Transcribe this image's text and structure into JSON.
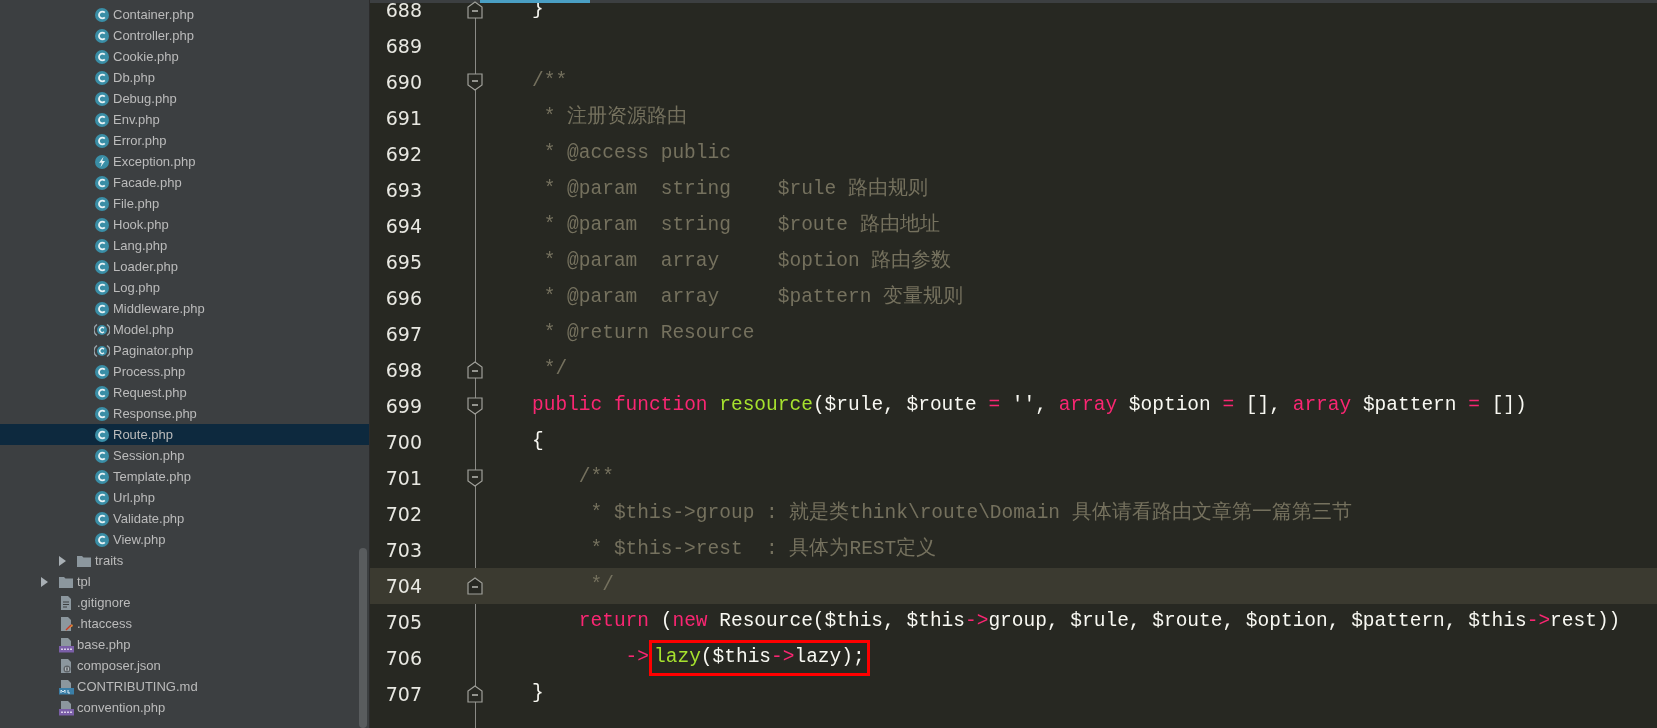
{
  "sidebar": {
    "tree": [
      {
        "children": [
          {
            "children": [
              {
                "label": "Container.php",
                "kind": "class",
                "selected": false
              },
              {
                "label": "Controller.php",
                "kind": "class",
                "selected": false
              },
              {
                "label": "Cookie.php",
                "kind": "class",
                "selected": false
              },
              {
                "label": "Db.php",
                "kind": "class",
                "selected": false
              },
              {
                "label": "Debug.php",
                "kind": "class",
                "selected": false
              },
              {
                "label": "Env.php",
                "kind": "class",
                "selected": false
              },
              {
                "label": "Error.php",
                "kind": "class",
                "selected": false
              },
              {
                "label": "Exception.php",
                "kind": "exception",
                "selected": false
              },
              {
                "label": "Facade.php",
                "kind": "class",
                "selected": false
              },
              {
                "label": "File.php",
                "kind": "class",
                "selected": false
              },
              {
                "label": "Hook.php",
                "kind": "class",
                "selected": false
              },
              {
                "label": "Lang.php",
                "kind": "class",
                "selected": false
              },
              {
                "label": "Loader.php",
                "kind": "class",
                "selected": false
              },
              {
                "label": "Log.php",
                "kind": "class",
                "selected": false
              },
              {
                "label": "Middleware.php",
                "kind": "class",
                "selected": false
              },
              {
                "label": "Model.php",
                "kind": "abstract",
                "selected": false
              },
              {
                "label": "Paginator.php",
                "kind": "abstract",
                "selected": false
              },
              {
                "label": "Process.php",
                "kind": "class",
                "selected": false
              },
              {
                "label": "Request.php",
                "kind": "class",
                "selected": false
              },
              {
                "label": "Response.php",
                "kind": "class",
                "selected": false
              },
              {
                "label": "Route.php",
                "kind": "class",
                "selected": true
              },
              {
                "label": "Session.php",
                "kind": "class",
                "selected": false
              },
              {
                "label": "Template.php",
                "kind": "class",
                "selected": false
              },
              {
                "label": "Url.php",
                "kind": "class",
                "selected": false
              },
              {
                "label": "Validate.php",
                "kind": "class",
                "selected": false
              },
              {
                "label": "View.php",
                "kind": "class",
                "selected": false
              }
            ]
          },
          {
            "label": "traits",
            "kind": "folder",
            "selected": false,
            "expanded": false
          }
        ]
      },
      {
        "label": "tpl",
        "kind": "folder",
        "selected": false,
        "expanded": false
      },
      {
        "label": ".gitignore",
        "kind": "text",
        "selected": false
      },
      {
        "label": ".htaccess",
        "kind": "htaccess",
        "selected": false
      },
      {
        "label": "base.php",
        "kind": "php",
        "selected": false
      },
      {
        "label": "composer.json",
        "kind": "json",
        "selected": false
      },
      {
        "label": "CONTRIBUTING.md",
        "kind": "md",
        "selected": false
      },
      {
        "label": "convention.php",
        "kind": "php",
        "selected": false
      }
    ]
  },
  "editor": {
    "lines": [
      {
        "number": "688",
        "kind": "fold-end",
        "current": false,
        "tokens": [
          {
            "kind": "plain",
            "text": "}"
          }
        ]
      },
      {
        "number": "689",
        "kind": "plain",
        "current": false
      },
      {
        "number": "690",
        "kind": "fold-start",
        "current": false,
        "tokens": [
          {
            "kind": "comment",
            "text": "/**"
          }
        ]
      },
      {
        "number": "691",
        "kind": "plain",
        "current": false,
        "tokens": [
          {
            "kind": "comment",
            "text": " * 注册资源路由"
          }
        ]
      },
      {
        "number": "692",
        "kind": "plain",
        "current": false,
        "tokens": [
          {
            "kind": "comment",
            "text": " * @access public"
          }
        ]
      },
      {
        "number": "693",
        "kind": "plain",
        "current": false,
        "tokens": [
          {
            "kind": "comment",
            "text": " * @param  string    $rule 路由规则"
          }
        ]
      },
      {
        "number": "694",
        "kind": "plain",
        "current": false,
        "tokens": [
          {
            "kind": "comment",
            "text": " * @param  string    $route 路由地址"
          }
        ]
      },
      {
        "number": "695",
        "kind": "plain",
        "current": false,
        "tokens": [
          {
            "kind": "comment",
            "text": " * @param  array     $option 路由参数"
          }
        ]
      },
      {
        "number": "696",
        "kind": "plain",
        "current": false,
        "tokens": [
          {
            "kind": "comment",
            "text": " * @param  array     $pattern 变量规则"
          }
        ]
      },
      {
        "number": "697",
        "kind": "plain",
        "current": false,
        "tokens": [
          {
            "kind": "comment",
            "text": " * @return Resource"
          }
        ]
      },
      {
        "number": "698",
        "kind": "fold-end",
        "current": false,
        "tokens": [
          {
            "kind": "comment",
            "text": " */"
          }
        ]
      },
      {
        "number": "699",
        "kind": "fold-start",
        "current": false,
        "tokens": [
          {
            "kind": "keyword",
            "text": "public"
          },
          {
            "kind": "keyword",
            "text": " function"
          },
          {
            "kind": "function",
            "text": " resource"
          },
          {
            "kind": "plain",
            "text": "($rule, $route "
          },
          {
            "kind": "operator",
            "text": "="
          },
          {
            "kind": "plain",
            "text": " '', "
          },
          {
            "kind": "keyword",
            "text": "array"
          },
          {
            "kind": "plain",
            "text": " $option "
          },
          {
            "kind": "operator",
            "text": "="
          },
          {
            "kind": "plain",
            "text": " [], "
          },
          {
            "kind": "keyword",
            "text": "array"
          },
          {
            "kind": "plain",
            "text": " $pattern "
          },
          {
            "kind": "operator",
            "text": "="
          },
          {
            "kind": "plain",
            "text": " [])"
          }
        ]
      },
      {
        "number": "700",
        "kind": "plain",
        "current": false,
        "tokens": [
          {
            "kind": "plain",
            "text": "{"
          }
        ]
      },
      {
        "number": "701",
        "kind": "fold-start",
        "current": false,
        "tokens": [
          {
            "kind": "comment",
            "text": "    /**"
          }
        ]
      },
      {
        "number": "702",
        "kind": "plain",
        "current": false,
        "tokens": [
          {
            "kind": "comment",
            "text": "     * $this->group : 就是类think\\route\\Domain 具体请看路由文章第一篇第三节"
          }
        ]
      },
      {
        "number": "703",
        "kind": "plain",
        "current": false,
        "tokens": [
          {
            "kind": "comment",
            "text": "     * $this->rest  : 具体为REST定义"
          }
        ]
      },
      {
        "number": "704",
        "kind": "fold-end",
        "current": true,
        "tokens": [
          {
            "kind": "comment",
            "text": "     */"
          }
        ]
      },
      {
        "number": "705",
        "kind": "plain",
        "current": false,
        "tokens": [
          {
            "kind": "keyword",
            "text": "    return"
          },
          {
            "kind": "plain",
            "text": " ("
          },
          {
            "kind": "keyword",
            "text": "new"
          },
          {
            "kind": "plain",
            "text": " Resource($this, $this"
          },
          {
            "kind": "operator",
            "text": "->"
          },
          {
            "kind": "plain",
            "text": "group, $rule, $route, $option, $pattern, $this"
          },
          {
            "kind": "operator",
            "text": "->"
          },
          {
            "kind": "plain",
            "text": "rest))"
          }
        ]
      },
      {
        "number": "706",
        "kind": "plain",
        "current": false,
        "tokens": [
          {
            "kind": "operator",
            "text": "        ->"
          }
        ],
        "boxed": [
          {
            "kind": "function",
            "text": "lazy"
          },
          {
            "kind": "plain",
            "text": "($this"
          },
          {
            "kind": "operator",
            "text": "->"
          },
          {
            "kind": "plain",
            "text": "lazy);"
          }
        ]
      },
      {
        "number": "707",
        "kind": "fold-end",
        "current": false,
        "tokens": [
          {
            "kind": "plain",
            "text": "}"
          }
        ]
      }
    ]
  }
}
